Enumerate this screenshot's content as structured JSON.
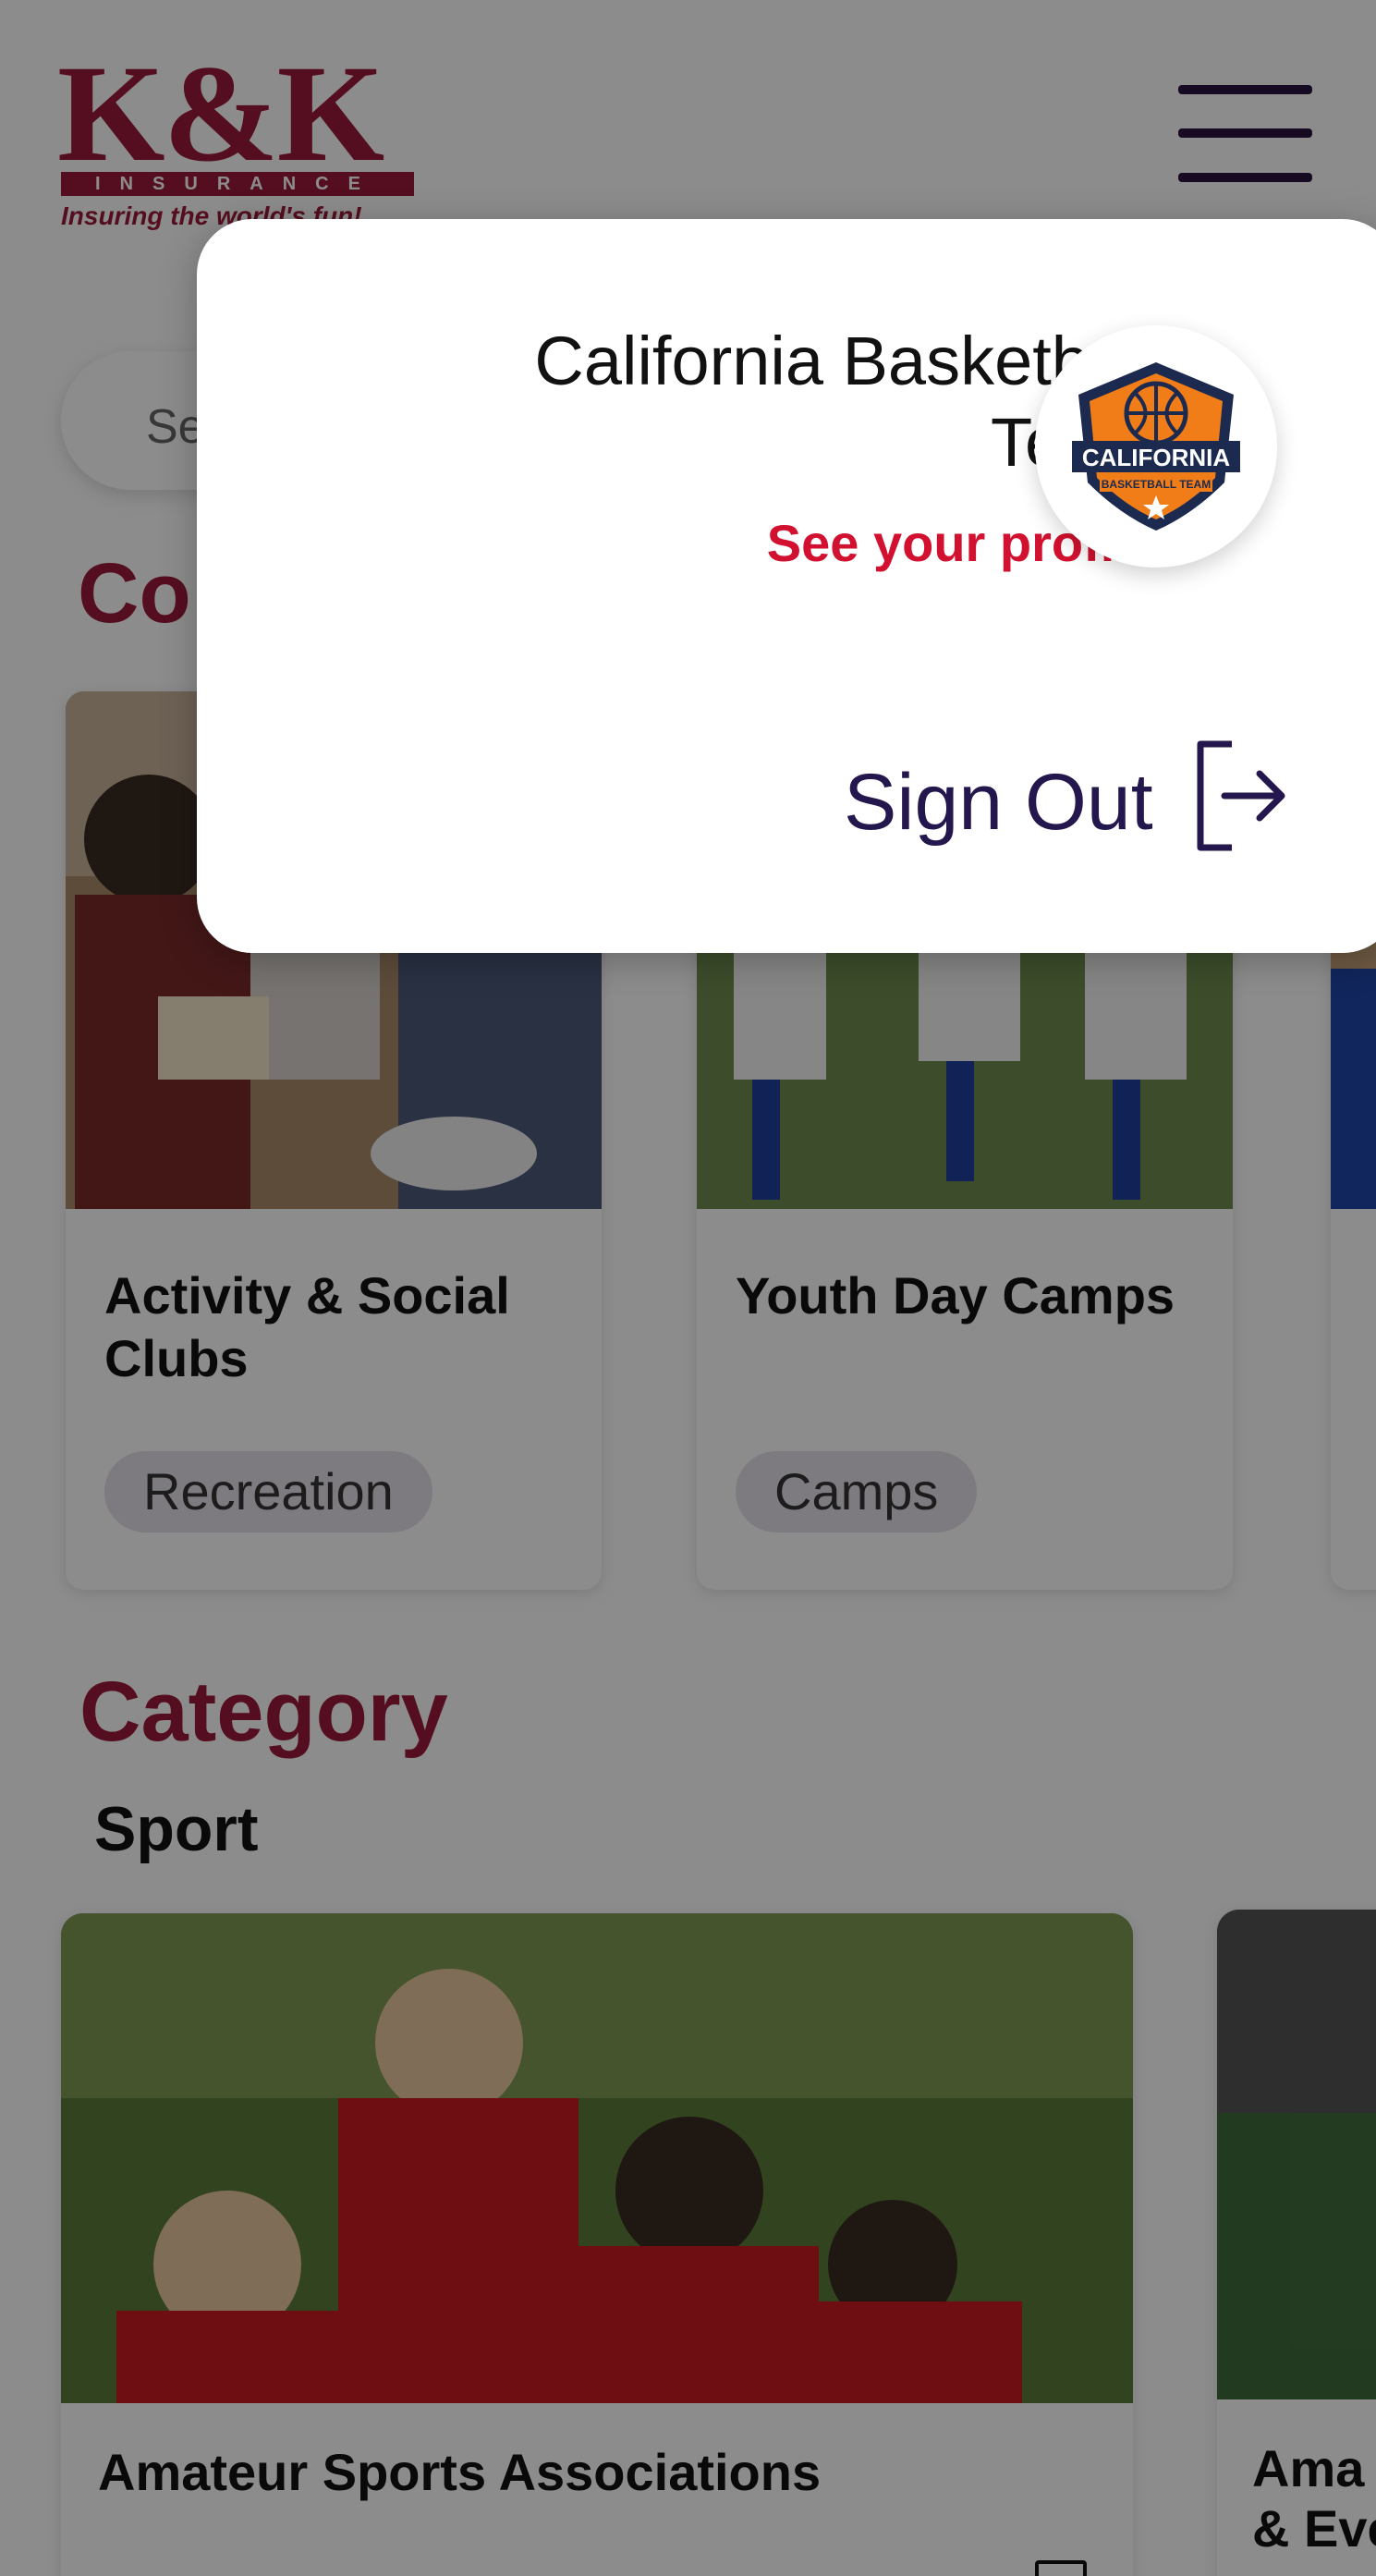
{
  "header": {
    "logo_text": "K&K",
    "logo_sub": "INSURANCE",
    "logo_tagline": "Insuring the world's fun!"
  },
  "search": {
    "placeholder": "Se"
  },
  "section_title_partial": "Co",
  "cards": [
    {
      "title": "Activity & Social Clubs",
      "tag": "Recreation"
    },
    {
      "title": "Youth Day Camps",
      "tag": "Camps"
    }
  ],
  "category": {
    "title": "Category",
    "subtitle": "Sport"
  },
  "sport_cards": [
    {
      "title": "Amateur Sports Associations"
    },
    {
      "title_line1": "Ama",
      "title_line2": "& Eve"
    }
  ],
  "popover": {
    "name": "California Basketball Team",
    "profile_link": "See your profile",
    "signout_label": "Sign Out",
    "avatar_text": "CALIFORNIA",
    "avatar_sub": "BASKETBALL TEAM"
  },
  "colors": {
    "brand": "#9b1b3a",
    "link_red": "#d2102f",
    "signout_navy": "#24174d",
    "overlay": "rgba(0,0,0,0.45)"
  }
}
